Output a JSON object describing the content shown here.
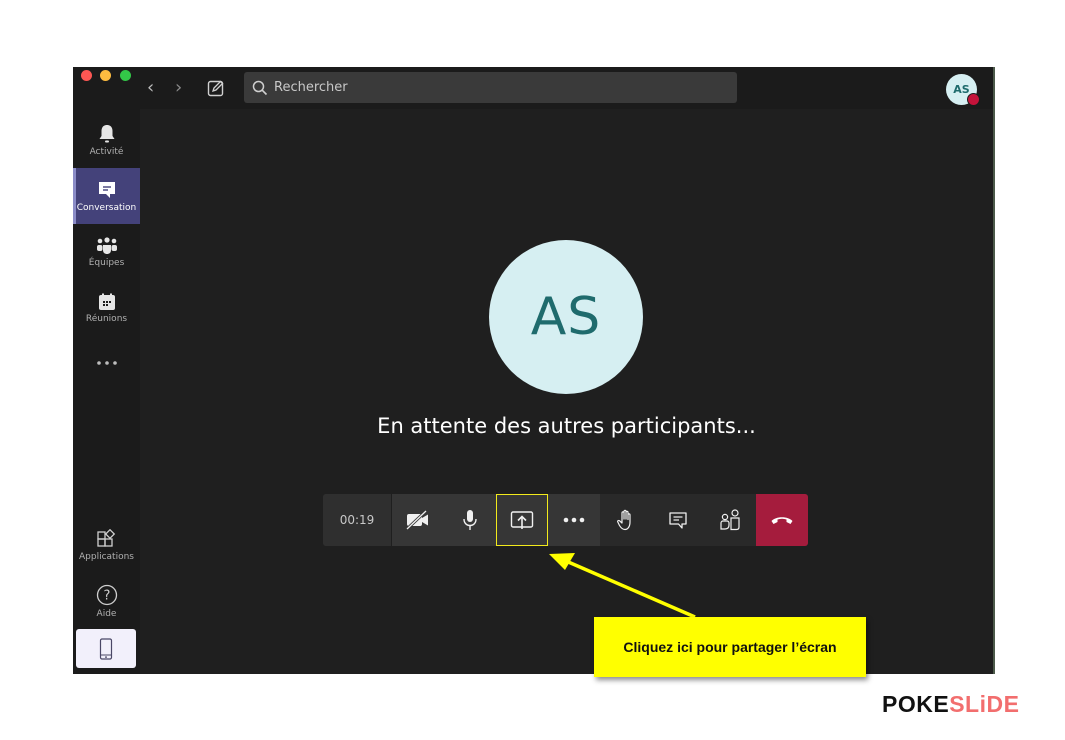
{
  "window": {
    "traffic_lights": [
      {
        "name": "close",
        "color": "#fc5753"
      },
      {
        "name": "minimize",
        "color": "#fdbc40"
      },
      {
        "name": "maximize",
        "color": "#33c748"
      }
    ]
  },
  "header": {
    "search_placeholder": "Rechercher",
    "user_initials": "AS",
    "status_color": "#c4133a"
  },
  "sidebar": {
    "items": [
      {
        "id": "activity",
        "label": "Activité",
        "icon": "bell-icon",
        "active": false
      },
      {
        "id": "chat",
        "label": "Conversation",
        "icon": "chat-icon",
        "active": true
      },
      {
        "id": "teams",
        "label": "Équipes",
        "icon": "teams-icon",
        "active": false
      },
      {
        "id": "meetings",
        "label": "Réunions",
        "icon": "calendar-icon",
        "active": false
      },
      {
        "id": "more",
        "label": "",
        "icon": "more-icon",
        "active": false
      }
    ],
    "bottom_items": [
      {
        "id": "apps",
        "label": "Applications",
        "icon": "apps-icon"
      },
      {
        "id": "help",
        "label": "Aide",
        "icon": "help-icon"
      }
    ],
    "device_icon": "mobile-device-icon"
  },
  "stage": {
    "avatar_initials": "AS",
    "waiting_text": "En attente des autres participants..."
  },
  "callbar": {
    "timer": "00:19",
    "buttons": [
      {
        "id": "camera",
        "icon": "camera-off-icon"
      },
      {
        "id": "mic",
        "icon": "microphone-icon"
      },
      {
        "id": "share",
        "icon": "share-screen-icon",
        "highlighted": true
      },
      {
        "id": "more",
        "icon": "more-options-icon"
      },
      {
        "id": "raise-hand",
        "icon": "hand-icon"
      },
      {
        "id": "chat",
        "icon": "chat-icon"
      },
      {
        "id": "participants",
        "icon": "participants-icon"
      },
      {
        "id": "hangup",
        "icon": "hang-up-icon"
      }
    ],
    "hangup_color": "#a51c3d"
  },
  "annotation": {
    "callout_text": "Cliquez ici pour partager l’écran",
    "color": "#ffff00"
  },
  "branding": {
    "part1": "POKE",
    "part2": "SLiDE"
  }
}
